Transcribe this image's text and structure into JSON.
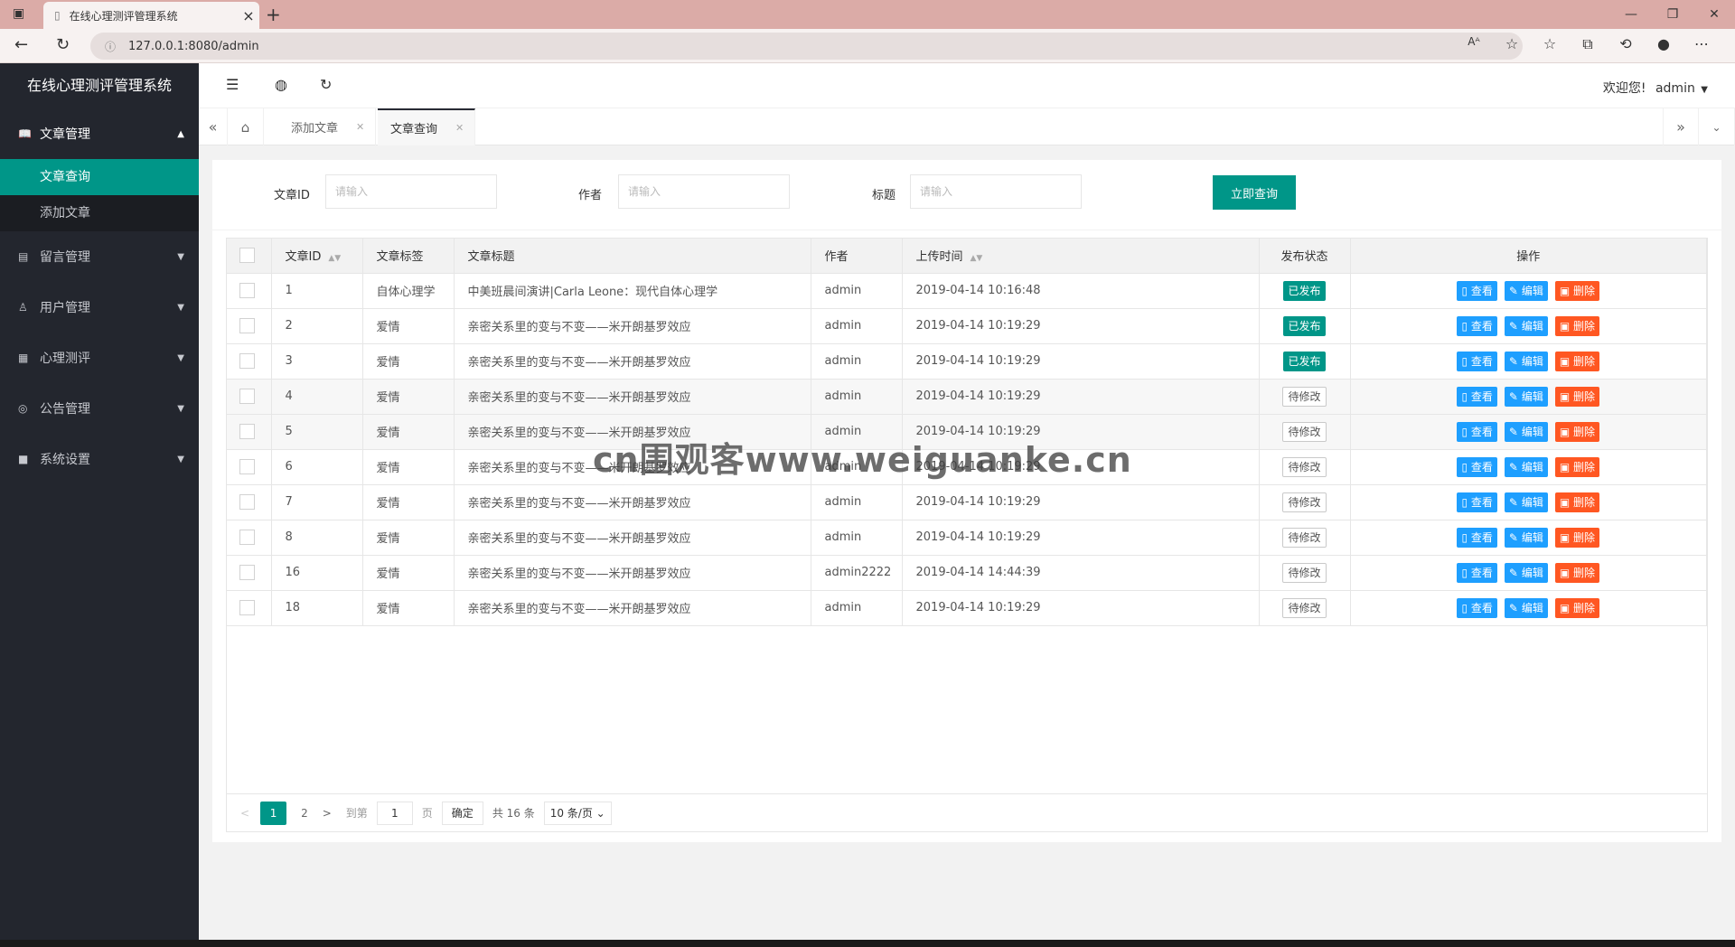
{
  "browser": {
    "tab_title": "在线心理测评管理系统",
    "new_tab": "+",
    "url": "127.0.0.1:8080/admin",
    "min": "—",
    "restore": "❐",
    "close": "✕"
  },
  "sidebar": {
    "logo": "在线心理测评管理系统",
    "groups": [
      {
        "label": "文章管理",
        "icon": "book-icon",
        "open": true,
        "items": [
          {
            "label": "文章查询",
            "active": true
          },
          {
            "label": "添加文章",
            "active": false
          }
        ]
      },
      {
        "label": "留言管理",
        "icon": "message-icon"
      },
      {
        "label": "用户管理",
        "icon": "user-icon"
      },
      {
        "label": "心理测评",
        "icon": "clipboard-icon"
      },
      {
        "label": "公告管理",
        "icon": "announce-icon"
      },
      {
        "label": "系统设置",
        "icon": "settings-icon"
      }
    ]
  },
  "header": {
    "greeting": "欢迎您!",
    "username": "admin"
  },
  "page_tabs": [
    {
      "label": "添加文章",
      "active": false
    },
    {
      "label": "文章查询",
      "active": true
    }
  ],
  "search": {
    "id_label": "文章ID",
    "author_label": "作者",
    "title_label": "标题",
    "placeholder": "请输入",
    "submit": "立即查询"
  },
  "table": {
    "columns": [
      "文章ID",
      "文章标签",
      "文章标题",
      "作者",
      "上传时间",
      "发布状态",
      "操作"
    ],
    "rows": [
      {
        "id": "1",
        "tag": "自体心理学",
        "title": "中美班晨间演讲|Carla Leone：现代自体心理学",
        "author": "admin",
        "time": "2019-04-14 10:16:48",
        "status": "已发布",
        "published": true
      },
      {
        "id": "2",
        "tag": "爱情",
        "title": "亲密关系里的变与不变——米开朗基罗效应",
        "author": "admin",
        "time": "2019-04-14 10:19:29",
        "status": "已发布",
        "published": true
      },
      {
        "id": "3",
        "tag": "爱情",
        "title": "亲密关系里的变与不变——米开朗基罗效应",
        "author": "admin",
        "time": "2019-04-14 10:19:29",
        "status": "已发布",
        "published": true
      },
      {
        "id": "4",
        "tag": "爱情",
        "title": "亲密关系里的变与不变——米开朗基罗效应",
        "author": "admin",
        "time": "2019-04-14 10:19:29",
        "status": "待修改",
        "published": false
      },
      {
        "id": "5",
        "tag": "爱情",
        "title": "亲密关系里的变与不变——米开朗基罗效应",
        "author": "admin",
        "time": "2019-04-14 10:19:29",
        "status": "待修改",
        "published": false
      },
      {
        "id": "6",
        "tag": "爱情",
        "title": "亲密关系里的变与不变——米开朗基罗效应",
        "author": "admin",
        "time": "2019-04-14 10:19:29",
        "status": "待修改",
        "published": false
      },
      {
        "id": "7",
        "tag": "爱情",
        "title": "亲密关系里的变与不变——米开朗基罗效应",
        "author": "admin",
        "time": "2019-04-14 10:19:29",
        "status": "待修改",
        "published": false
      },
      {
        "id": "8",
        "tag": "爱情",
        "title": "亲密关系里的变与不变——米开朗基罗效应",
        "author": "admin",
        "time": "2019-04-14 10:19:29",
        "status": "待修改",
        "published": false
      },
      {
        "id": "16",
        "tag": "爱情",
        "title": "亲密关系里的变与不变——米开朗基罗效应",
        "author": "admin2222",
        "time": "2019-04-14 14:44:39",
        "status": "待修改",
        "published": false
      },
      {
        "id": "18",
        "tag": "爱情",
        "title": "亲密关系里的变与不变——米开朗基罗效应",
        "author": "admin",
        "time": "2019-04-14 10:19:29",
        "status": "待修改",
        "published": false
      }
    ],
    "actions": {
      "view": "查看",
      "edit": "编辑",
      "delete": "删除"
    }
  },
  "pager": {
    "prev": "<",
    "pages": [
      "1",
      "2"
    ],
    "next": ">",
    "goto_label": "到第",
    "goto_value": "1",
    "page_unit": "页",
    "confirm": "确定",
    "total": "共 16 条",
    "per_page": "10 条/页"
  },
  "watermark": "cn围观客www.weiguanke.cn",
  "colors": {
    "primary": "#009688",
    "sidebar": "#23262e",
    "info": "#1e9fff",
    "danger": "#ff5722"
  }
}
